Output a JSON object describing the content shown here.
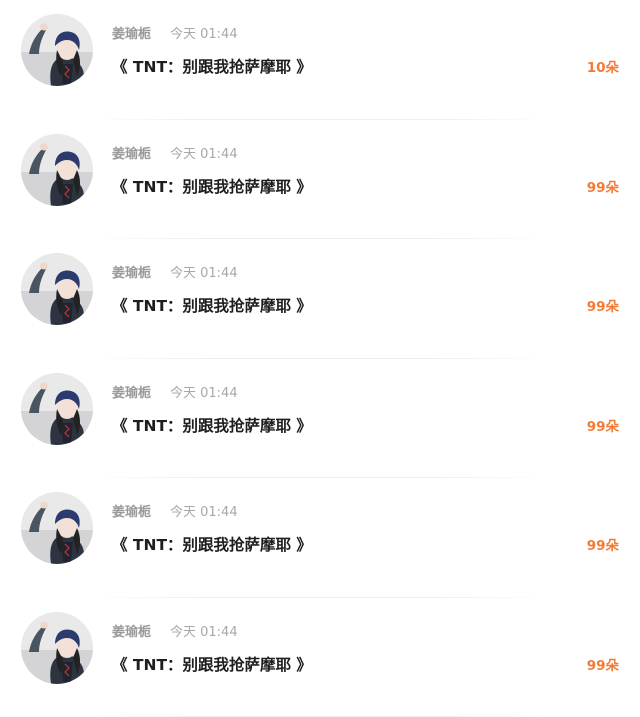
{
  "messages": [
    {
      "username": "姜瑜栀",
      "time": "今天 01:44",
      "title": "《 TNT：别跟我抢萨摩耶 》",
      "count": "10朵"
    },
    {
      "username": "姜瑜栀",
      "time": "今天 01:44",
      "title": "《 TNT：别跟我抢萨摩耶 》",
      "count": "99朵"
    },
    {
      "username": "姜瑜栀",
      "time": "今天 01:44",
      "title": "《 TNT：别跟我抢萨摩耶 》",
      "count": "99朵"
    },
    {
      "username": "姜瑜栀",
      "time": "今天 01:44",
      "title": "《 TNT：别跟我抢萨摩耶 》",
      "count": "99朵"
    },
    {
      "username": "姜瑜栀",
      "time": "今天 01:44",
      "title": "《 TNT：别跟我抢萨摩耶 》",
      "count": "99朵"
    },
    {
      "username": "姜瑜栀",
      "time": "今天 01:44",
      "title": "《 TNT：别跟我抢萨摩耶 》",
      "count": "99朵"
    }
  ],
  "colors": {
    "count_accent": "#f47b35",
    "username_gray": "#9a9a9a",
    "title_dark": "#1e1e1e"
  },
  "icons": {
    "avatar": "avatar-photo-icon"
  }
}
